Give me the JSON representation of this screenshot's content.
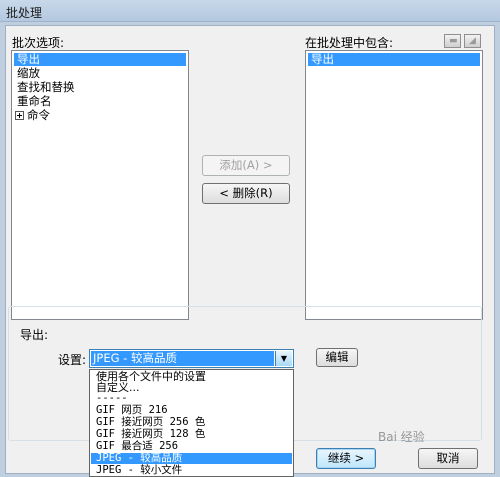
{
  "window": {
    "title": "批处理"
  },
  "batch_options": {
    "label": "批次选项:",
    "items": [
      {
        "label": "导出",
        "selected": true
      },
      {
        "label": "缩放",
        "selected": false
      },
      {
        "label": "查找和替换",
        "selected": false
      },
      {
        "label": "重命名",
        "selected": false
      },
      {
        "label": "命令",
        "selected": false,
        "expandable": true
      }
    ]
  },
  "included": {
    "label": "在批处理中包含:",
    "items": [
      {
        "label": "导出",
        "selected": true
      }
    ]
  },
  "buttons": {
    "add": "添加(A) >",
    "remove": "< 删除(R)",
    "edit": "编辑",
    "continue": "继续 >",
    "cancel": "取消"
  },
  "export": {
    "group_label": "导出:",
    "settings_label": "设置:",
    "selected_value": "JPEG - 较高品质",
    "options": [
      {
        "label": "使用各个文件中的设置",
        "mono": false,
        "selected": false
      },
      {
        "label": "自定义...",
        "mono": false,
        "selected": false
      },
      {
        "label": "-----",
        "mono": true,
        "selected": false
      },
      {
        "label": "GIF 网页 216",
        "mono": true,
        "selected": false
      },
      {
        "label": "GIF 接近网页 256 色",
        "mono": true,
        "selected": false
      },
      {
        "label": "GIF 接近网页 128 色",
        "mono": true,
        "selected": false
      },
      {
        "label": "GIF 最合适 256",
        "mono": true,
        "selected": false
      },
      {
        "label": "JPEG - 较高品质",
        "mono": true,
        "selected": true
      },
      {
        "label": "JPEG - 较小文件",
        "mono": true,
        "selected": false
      }
    ]
  },
  "watermark": "Bai 经验",
  "colors": {
    "selection": "#3399ff",
    "dialog_bg": "#f0f0f0",
    "frame": "#bfcfe0"
  }
}
